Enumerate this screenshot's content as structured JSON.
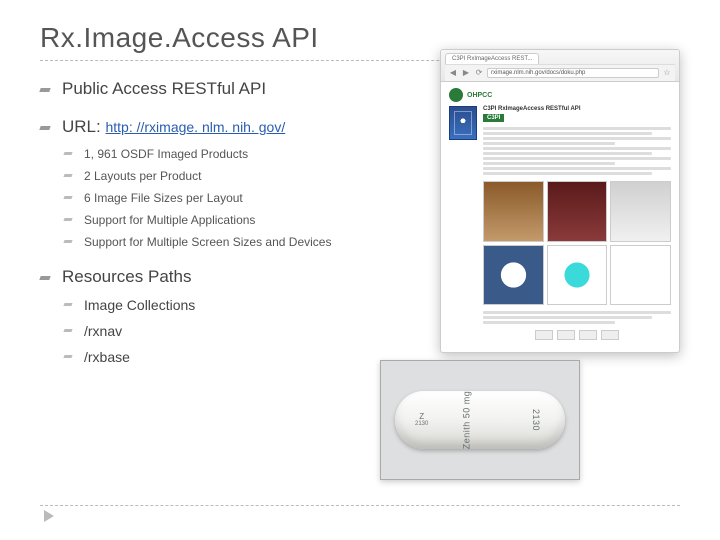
{
  "title": "Rx.Image.Access API",
  "bullets": {
    "b1": "Public Access RESTful API",
    "b2_label": "URL: ",
    "b2_link": "http: //rximage. nlm. nih. gov/",
    "b2_sub": [
      "1, 961 OSDF Imaged Products",
      "2 Layouts per Product",
      "6 Image File Sizes per Layout",
      "Support for Multiple Applications",
      "Support for Multiple Screen Sizes and Devices"
    ],
    "b3": "Resources Paths",
    "b3_sub": [
      "Image Collections",
      "/rxnav",
      "/rxbase"
    ]
  },
  "browser": {
    "tab": "C3PI RxImageAccess REST...",
    "url": "rximage.nlm.nih.gov/docs/doku.php",
    "ohpcc": "OHPCC",
    "page_title": "C3PI RxImageAccess RESTful API",
    "c3pi": "C3PI"
  },
  "pill": {
    "left_top": "Z",
    "left_bottom": "2130",
    "imprint_left": "Zenith 50 mg",
    "imprint_right": "2130"
  }
}
